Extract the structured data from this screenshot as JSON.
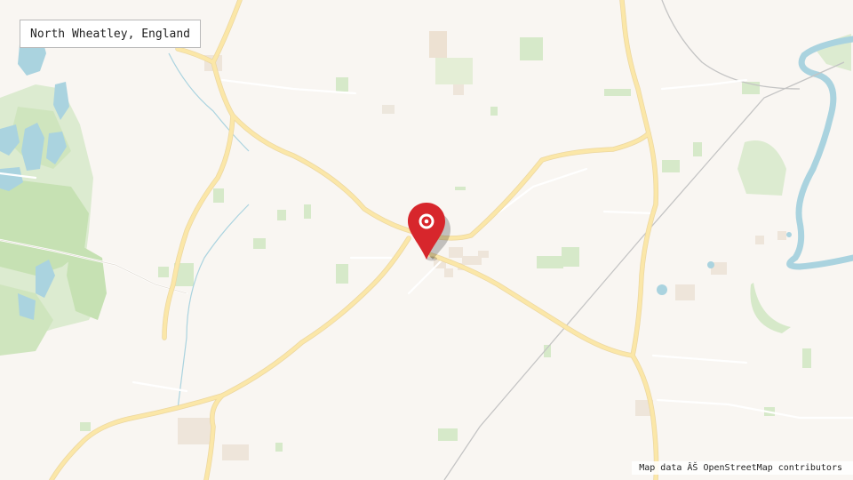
{
  "map": {
    "location_label": "North Wheatley, England",
    "attribution": "Map data ÂŠ OpenStreetMap contributors",
    "marker": {
      "icon": "map-pin-icon",
      "color": "#d7262c"
    },
    "colors": {
      "land": "#f9f6f2",
      "road_major": "#fbe6a2",
      "road_minor": "#ffffff",
      "water": "#aad3df",
      "vegetation": "#d6e9c9",
      "woodland": "#c6e1b3",
      "buildings": "#eee5da",
      "railway": "#bdbdbd"
    }
  }
}
